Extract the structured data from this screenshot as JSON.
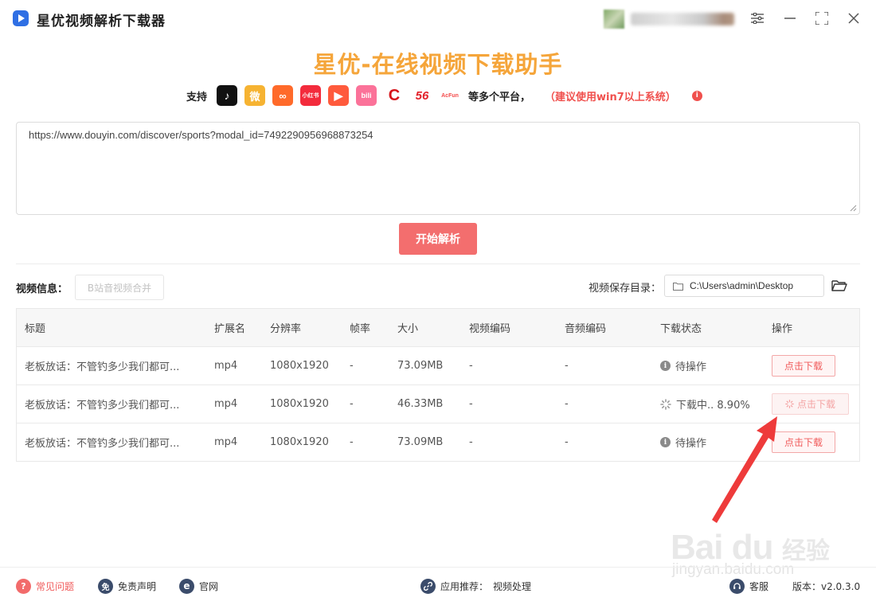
{
  "app": {
    "title": "星优视频解析下载器"
  },
  "header": {
    "heading": "星优-在线视频下载助手",
    "support_label": "支持",
    "platforms": [
      {
        "name": "douyin-icon",
        "glyph": "♪",
        "color": "#111111"
      },
      {
        "name": "weibo-icon",
        "glyph": "微",
        "color": "#f6b332"
      },
      {
        "name": "kuaishou-icon",
        "glyph": "∞",
        "color": "#ff6a2a"
      },
      {
        "name": "xiaohongshu-icon",
        "glyph": "小红书",
        "color": "#f32b3c"
      },
      {
        "name": "video-play-icon",
        "glyph": "▶",
        "color": "#ff5a3c"
      },
      {
        "name": "bilibili-icon",
        "glyph": "bili",
        "color": "#fb7299"
      },
      {
        "name": "cctv-icon",
        "glyph": "C",
        "color": "#d6141a"
      },
      {
        "name": "56-icon",
        "glyph": "56",
        "color": "#e3222b"
      },
      {
        "name": "acfun-icon",
        "glyph": "AcFun",
        "color": "#f44b4b"
      }
    ],
    "more_label": "等多个平台，",
    "hint": "（建议使用win7以上系统）"
  },
  "input": {
    "url": "https://www.douyin.com/discover/sports?modal_id=7492290956968873254"
  },
  "parse_button": "开始解析",
  "info": {
    "video_info_label": "视频信息：",
    "merge_button": "B站音视频合并",
    "save_dir_label": "视频保存目录：",
    "save_dir_value": "C:\\Users\\admin\\Desktop"
  },
  "table": {
    "headers": [
      "标题",
      "扩展名",
      "分辨率",
      "帧率",
      "大小",
      "视频编码",
      "音频编码",
      "下载状态",
      "操作"
    ],
    "rows": [
      {
        "title": "老板放话：不管钓多少我们都可...",
        "ext": "mp4",
        "res": "1080x1920",
        "fps": "-",
        "size": "73.09MB",
        "vcodec": "-",
        "acodec": "-",
        "status": "待操作",
        "status_type": "pending",
        "action": "点击下载"
      },
      {
        "title": "老板放话：不管钓多少我们都可...",
        "ext": "mp4",
        "res": "1080x1920",
        "fps": "-",
        "size": "46.33MB",
        "vcodec": "-",
        "acodec": "-",
        "status": "下载中.. 8.90%",
        "status_type": "downloading",
        "action": "点击下载"
      },
      {
        "title": "老板放话：不管钓多少我们都可...",
        "ext": "mp4",
        "res": "1080x1920",
        "fps": "-",
        "size": "73.09MB",
        "vcodec": "-",
        "acodec": "-",
        "status": "待操作",
        "status_type": "pending",
        "action": "点击下载"
      }
    ]
  },
  "watermark": {
    "logo": "Bai du",
    "text": "经验",
    "url": "jingyan.baidu.com"
  },
  "footer": {
    "faq": "常见问题",
    "disclaimer": "免责声明",
    "website": "官网",
    "recommend_label": "应用推荐：",
    "recommend_value": "视频处理",
    "support": "客服",
    "version": "版本：v2.0.3.0"
  },
  "colors": {
    "accent": "#f36e6e",
    "heading": "#f5a53a",
    "hint": "#f0504d"
  }
}
